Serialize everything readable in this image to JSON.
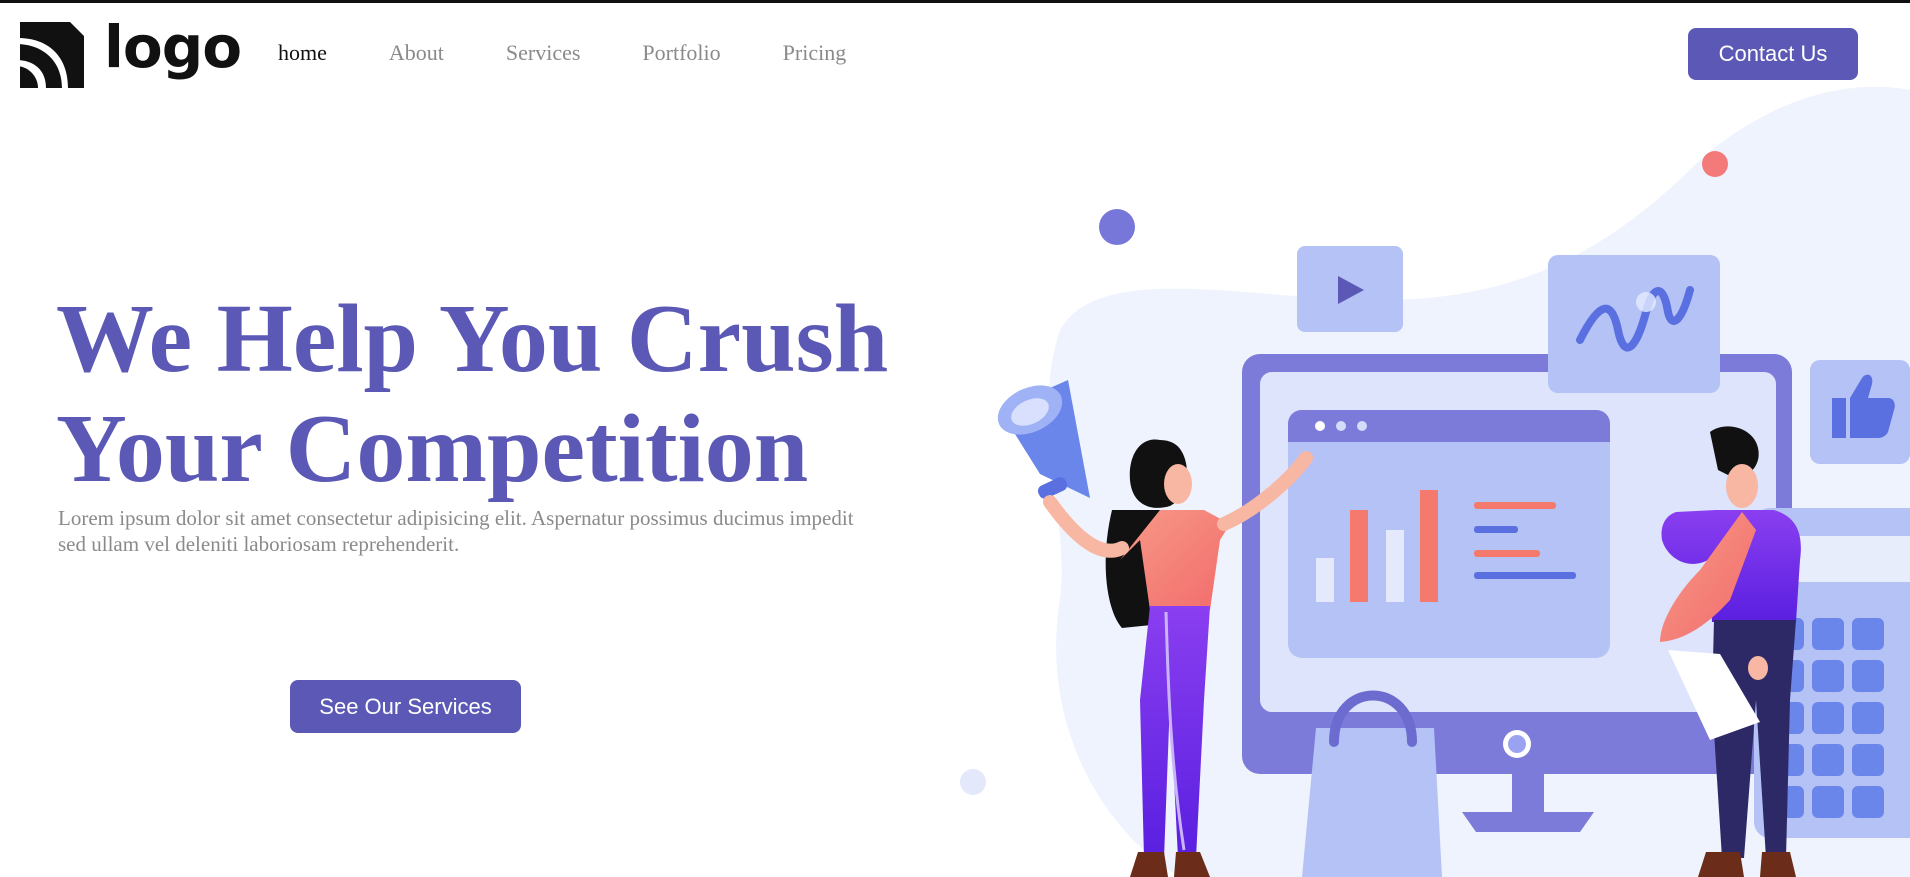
{
  "header": {
    "logo_text": "logo",
    "nav": [
      {
        "label": "home",
        "active": true
      },
      {
        "label": "About"
      },
      {
        "label": "Services"
      },
      {
        "label": "Portfolio"
      },
      {
        "label": "Pricing"
      }
    ],
    "contact_label": "Contact Us"
  },
  "hero": {
    "title_line1": "We Help You Crush",
    "title_line2": "Your Competition",
    "text": "Lorem ipsum dolor sit amet consectetur adipisicing elit. Aspernatur possimus ducimus impedit sed ullam vel deleniti laboriosam reprehenderit.",
    "cta_label": "See Our Services"
  },
  "colors": {
    "accent": "#5b59b5",
    "nav_inactive": "#8a8a8a",
    "blob": "#eef3fd",
    "coral": "#f47a6e"
  },
  "icons": [
    "logo-mark-icon",
    "megaphone-icon",
    "play-icon",
    "wave-chart-icon",
    "thumbs-up-icon",
    "shopping-bag-icon"
  ]
}
